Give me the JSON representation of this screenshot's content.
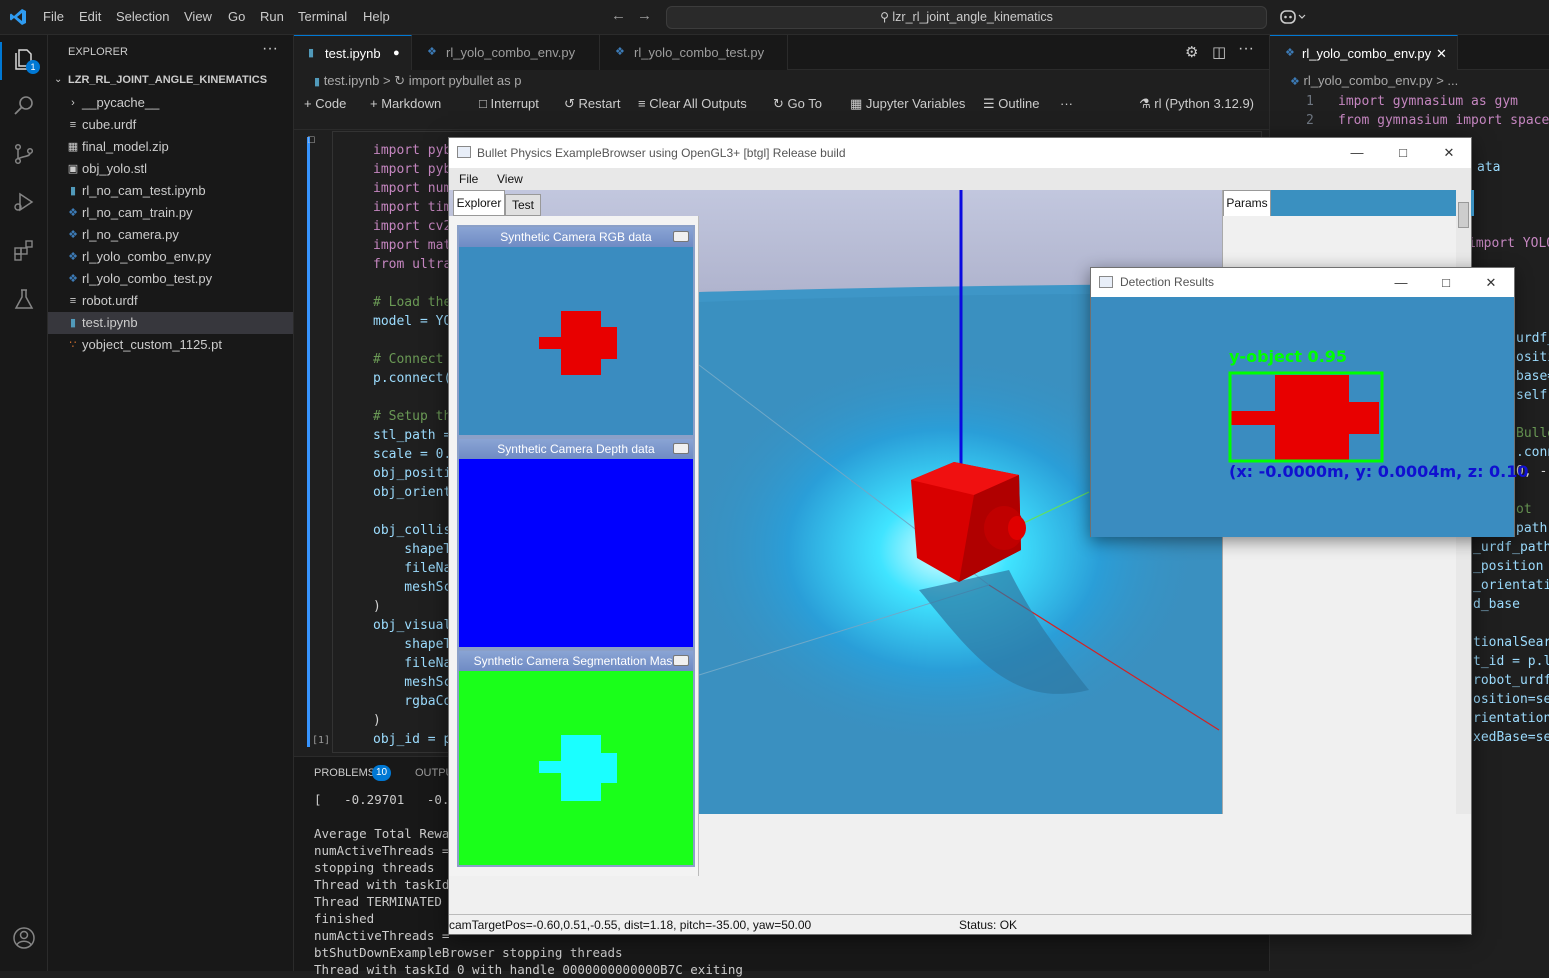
{
  "titlebar": {
    "menu": [
      "File",
      "Edit",
      "Selection",
      "View",
      "Go",
      "Run",
      "Terminal",
      "Help"
    ],
    "search": "lzr_rl_joint_angle_kinematics"
  },
  "activity": {
    "explorer_badge": "1"
  },
  "sidebar": {
    "header": "EXPLORER",
    "root": "LZR_RL_JOINT_ANGLE_KINEMATICS",
    "items": [
      {
        "label": "__pycache__",
        "icon": "chevron-right-icon"
      },
      {
        "label": "cube.urdf",
        "icon": "lines-file-icon"
      },
      {
        "label": "final_model.zip",
        "icon": "zip-file-icon"
      },
      {
        "label": "obj_yolo.stl",
        "icon": "file-icon"
      },
      {
        "label": "rl_no_cam_test.ipynb",
        "icon": "notebook-file-icon"
      },
      {
        "label": "rl_no_cam_train.py",
        "icon": "python-file-icon"
      },
      {
        "label": "rl_no_camera.py",
        "icon": "python-file-icon"
      },
      {
        "label": "rl_yolo_combo_env.py",
        "icon": "python-file-icon"
      },
      {
        "label": "rl_yolo_combo_test.py",
        "icon": "python-file-icon"
      },
      {
        "label": "robot.urdf",
        "icon": "lines-file-icon"
      },
      {
        "label": "test.ipynb",
        "icon": "notebook-file-icon"
      },
      {
        "label": "yobject_custom_1125.pt",
        "icon": "rss-file-icon"
      }
    ]
  },
  "editor": {
    "tabs": [
      {
        "label": "test.ipynb",
        "dirty": "●"
      },
      {
        "label": "rl_yolo_combo_env.py"
      },
      {
        "label": "rl_yolo_combo_test.py"
      }
    ],
    "breadcrumb": {
      "file": "test.ipynb",
      "sep": ">",
      "cell": "import pybullet as p"
    },
    "toolbar": {
      "code": "Code",
      "markdown": "Markdown",
      "interrupt": "Interrupt",
      "restart": "Restart",
      "clear": "Clear All Outputs",
      "goto": "Go To",
      "variables": "Jupyter Variables",
      "outline": "Outline",
      "more": "···",
      "kernel": "rl (Python 3.12.9)"
    },
    "cell_exec": "[1]",
    "code_lines": [
      "import pyb",
      "import pyb",
      "import num",
      "import tim",
      "import cv2",
      "import mat",
      "from ultra",
      "",
      "# Load the",
      "model = YO",
      "",
      "# Connect",
      "p.connect(",
      "",
      "# Setup th",
      "stl_path =",
      "scale = 0.",
      "obj_positi",
      "obj_orient",
      "",
      "obj_collis",
      "    shapeT",
      "    fileNa",
      "    meshSc",
      ")",
      "obj_visual",
      "    shapeT",
      "    fileNa",
      "    meshSc",
      "    rgbaCo",
      ")",
      "obj_id = p"
    ]
  },
  "right_editor": {
    "tab": "rl_yolo_combo_env.py",
    "breadcrumb": "rl_yolo_combo_env.py > ...",
    "line_numbers": [
      "1",
      "2"
    ],
    "lines": [
      "import gymnasium as gym",
      "from gymnasium import spaces"
    ],
    "fragments": [
      "ata",
      "import YOLO",
      "urdf_",
      "ositi",
      "base=",
      "self)",
      "Bulle",
      ".conn",
      "0, -",
      "ot",
      "path",
      "_urdf_path",
      "_position",
      "_orientatio",
      "d_base",
      "tionalSearc",
      "t_id = p.lo",
      "robot_urdf_",
      "osition=sel",
      "rientation=",
      "xedBase=sel"
    ]
  },
  "bullet": {
    "title": "Bullet Physics ExampleBrowser using OpenGL3+ [btgl] Release build",
    "menu": [
      "File",
      "View"
    ],
    "tabs": [
      "Explorer",
      "Test"
    ],
    "params_tab": "Params",
    "subwindows": [
      "Synthetic Camera RGB data",
      "Synthetic Camera Depth data",
      "Synthetic Camera Segmentation Mask"
    ],
    "status_left": "camTargetPos=-0.60,0.51,-0.55, dist=1.18, pitch=-35.00, yaw=50.00",
    "status_right": "Status: OK"
  },
  "detection": {
    "title": "Detection Results",
    "label": "y-object 0.95",
    "coords": "(x: -0.0000m, y: 0.0004m, z: 0.10"
  },
  "panel": {
    "problems": "PROBLEMS",
    "problems_count": "10",
    "output": "OUTPUT",
    "lines": [
      "[   -0.29701   -0.0",
      "",
      "Average Total Rewar",
      "numActiveThreads =",
      "stopping threads",
      "Thread with taskId",
      "Thread TERMINATED",
      "finished",
      "numActiveThreads =",
      "btShutDownExampleBrowser stopping threads",
      "Thread with taskId 0 with handle 0000000000000B7C exiting"
    ]
  },
  "colors": {
    "accent": "#0078d4",
    "scene_bg": "#3a90c0",
    "detect_box": "#00ff00",
    "object_red": "#ee0000"
  }
}
